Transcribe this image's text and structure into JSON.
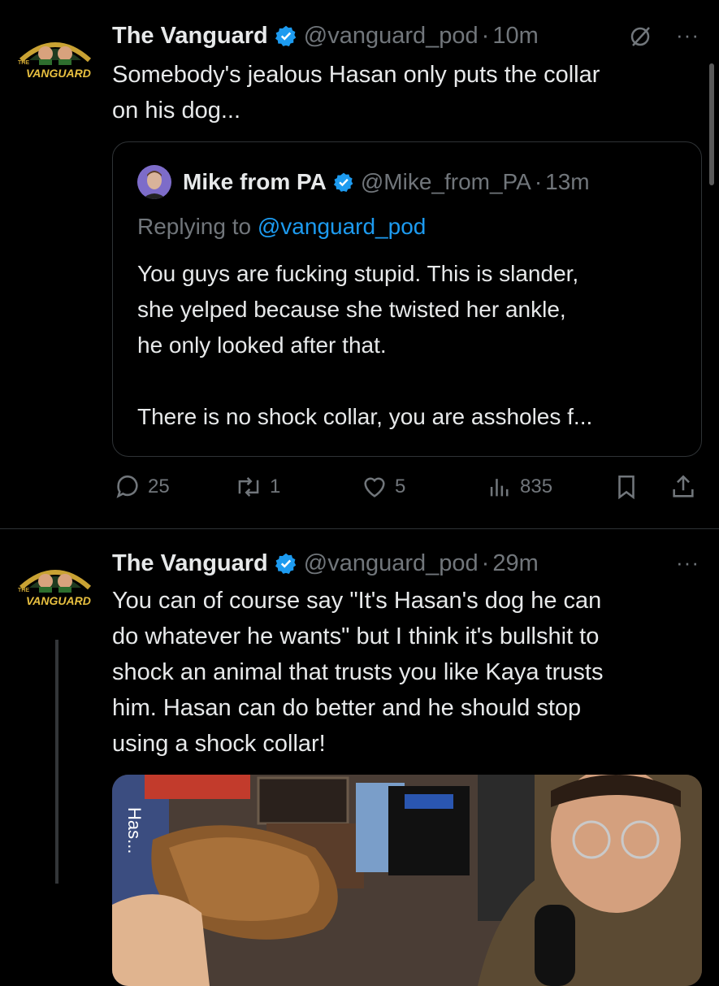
{
  "tweet1": {
    "logo_text": "VANGUARD",
    "logo_small": "THE",
    "name": "The Vanguard",
    "handle": "@vanguard_pod",
    "sep": "·",
    "time": "10m",
    "more": "···",
    "text_line1": "Somebody's jealous Hasan only puts the collar",
    "text_line2": "on his dog...",
    "quote": {
      "name": "Mike from PA",
      "handle": "@Mike_from_PA",
      "sep": "·",
      "time": "13m",
      "replying_prefix": "Replying to ",
      "replying_handle": "@vanguard_pod",
      "line1": "You guys are fucking stupid. This is slander,",
      "line2": "she yelped because she twisted her ankle,",
      "line3": "he only looked after that.",
      "line4": "There is no shock collar, you are assholes f..."
    },
    "actions": {
      "replies": "25",
      "reposts": "1",
      "likes": "5",
      "views": "835"
    }
  },
  "tweet2": {
    "logo_text": "VANGUARD",
    "logo_small": "THE",
    "name": "The Vanguard",
    "handle": "@vanguard_pod",
    "sep": "·",
    "time": "29m",
    "more": "···",
    "line1": "You can of course say \"It's Hasan's dog he can",
    "line2": "do whatever he wants\" but I think it's bullshit to",
    "line3": "shock an animal that trusts you like Kaya trusts",
    "line4": "him. Hasan can do better and he should stop",
    "line5": "using a shock collar!",
    "media_label": "Has..."
  },
  "colors": {
    "background": "#000000",
    "text": "#e7e9ea",
    "muted": "#71767b",
    "link": "#1d9bf0",
    "verified": "#1d9bf0",
    "border": "#2f3336"
  },
  "icons": [
    "verified-badge-icon",
    "grok-icon",
    "more-icon",
    "reply-icon",
    "repost-icon",
    "like-icon",
    "views-icon",
    "bookmark-icon",
    "share-icon"
  ]
}
